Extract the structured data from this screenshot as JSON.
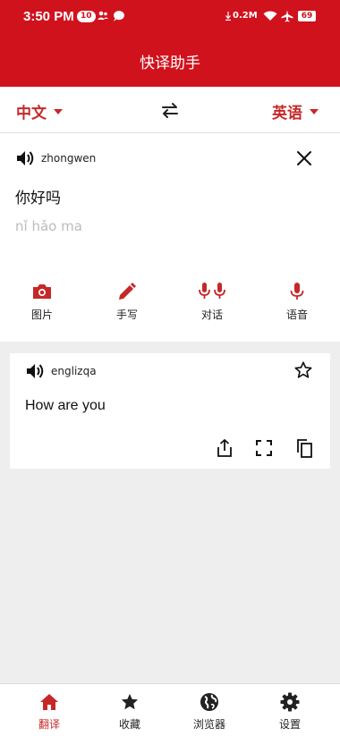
{
  "status_bar": {
    "time": "3:50 PM",
    "notification_count": "10",
    "net_speed": "0.2M",
    "battery": "69"
  },
  "app": {
    "title": "快译助手"
  },
  "languages": {
    "source": "中文",
    "target": "英语"
  },
  "input": {
    "speak_label": "zhongwen",
    "text": "你好吗",
    "pinyin": "nǐ hǎo ma"
  },
  "tools": [
    {
      "label": "图片",
      "icon": "camera-icon"
    },
    {
      "label": "手写",
      "icon": "pen-icon"
    },
    {
      "label": "对话",
      "icon": "dual-mic-icon"
    },
    {
      "label": "语音",
      "icon": "mic-icon"
    }
  ],
  "output": {
    "speak_label": "englizqa",
    "text": "How are you"
  },
  "bottom_nav": [
    {
      "label": "翻译",
      "icon": "home-icon",
      "active": true
    },
    {
      "label": "收藏",
      "icon": "star-icon",
      "active": false
    },
    {
      "label": "浏览器",
      "icon": "globe-icon",
      "active": false
    },
    {
      "label": "设置",
      "icon": "gear-icon",
      "active": false
    }
  ],
  "colors": {
    "primary": "#d0121d",
    "accent_text": "#c62828",
    "background": "#eeeeee"
  }
}
